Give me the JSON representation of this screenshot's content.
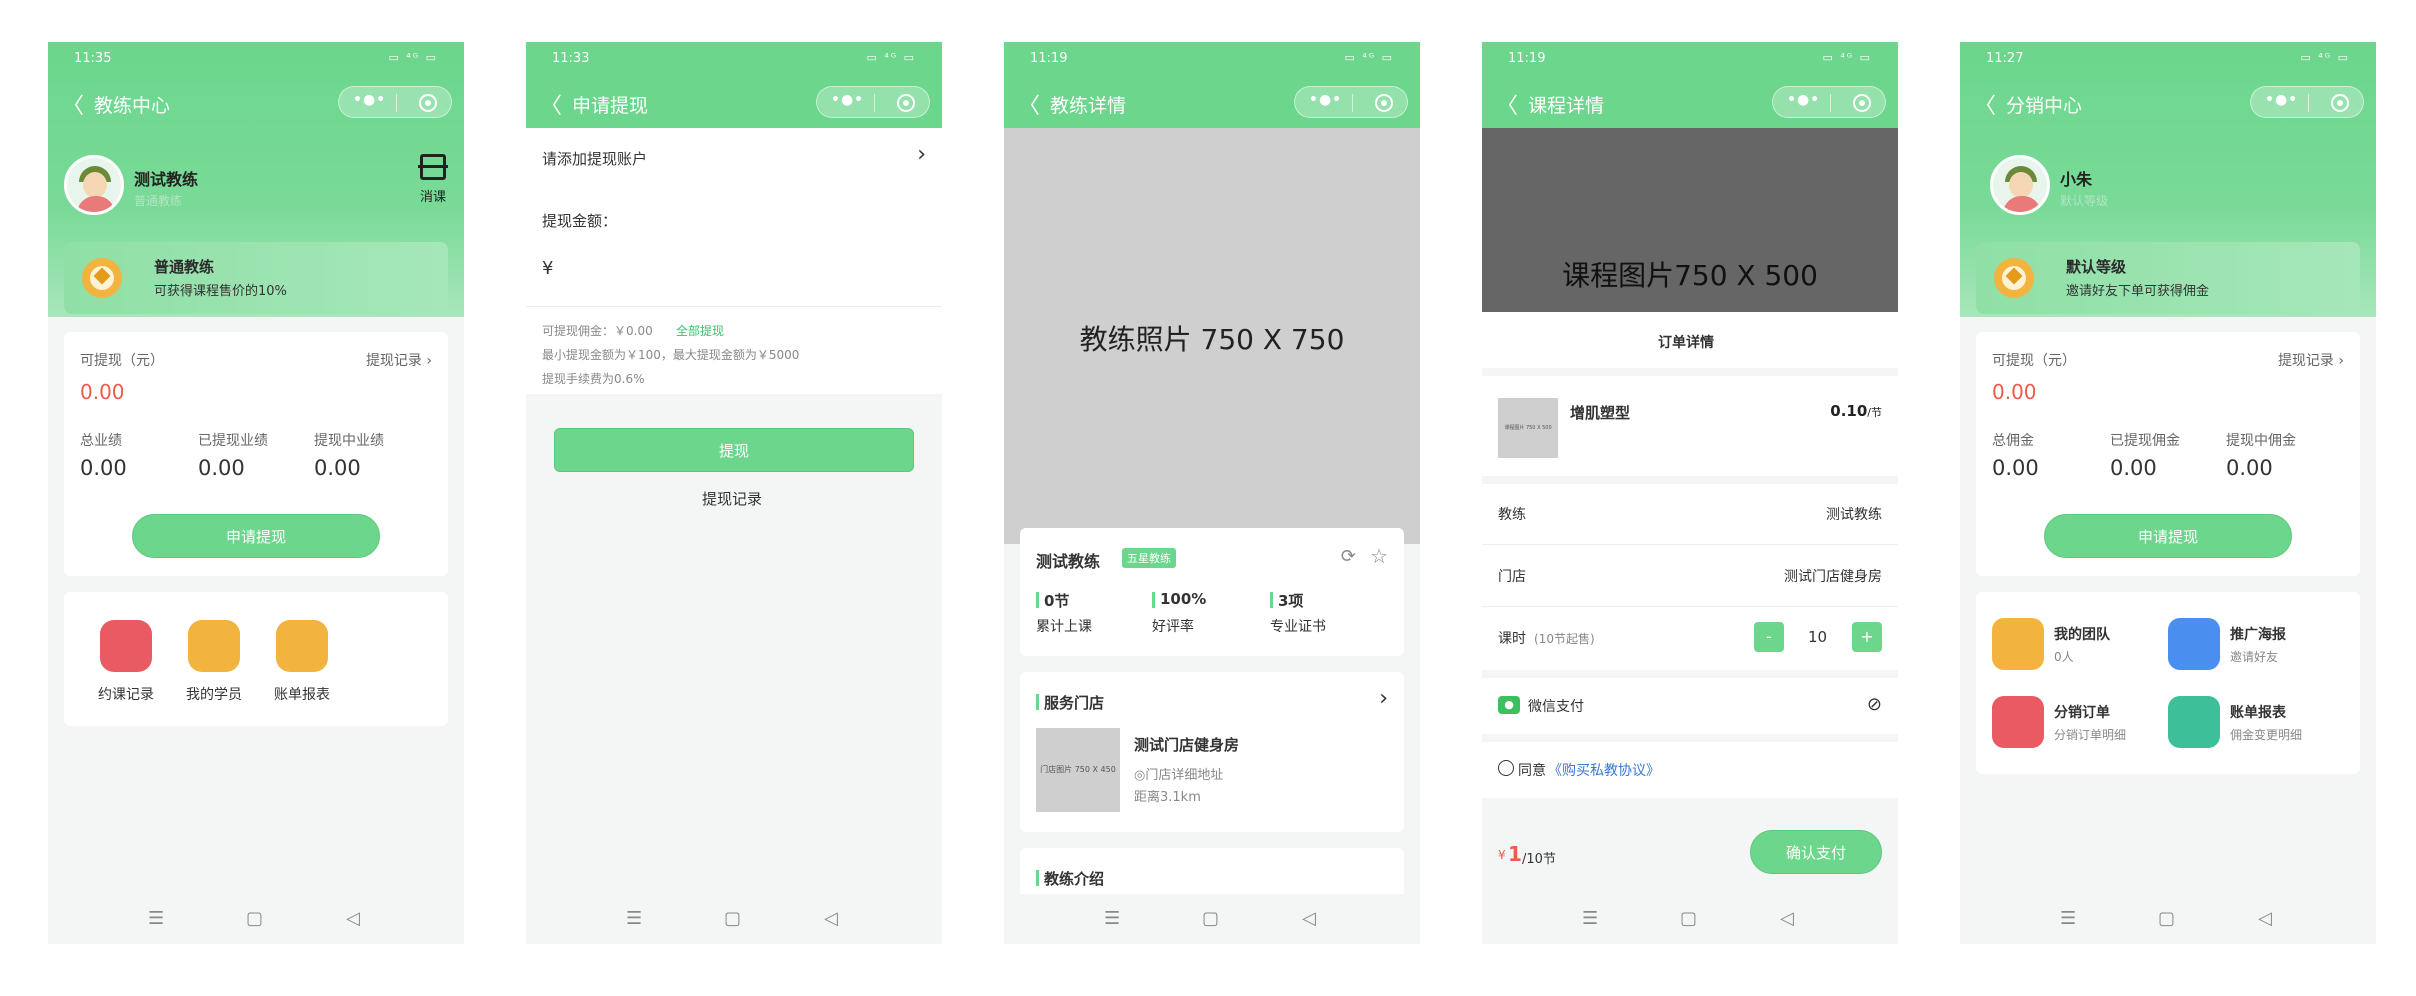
{
  "system": {
    "menu_icon": "☰",
    "home_icon": "▢",
    "back_icon": "◁",
    "back_arrow": "〈",
    "battery": "▭ ⁴ᴳ ▭"
  },
  "p1": {
    "time": "11:35",
    "title": "教练中心",
    "user_name": "测试教练",
    "user_role": "普通教练",
    "scan_label": "消课",
    "level_name": "普通教练",
    "level_desc": "可获得课程售价的10%",
    "withdrawable_label": "可提现（元）",
    "withdrawable_value": "0.00",
    "withdraw_record": "提现记录",
    "stats": [
      {
        "label": "总业绩",
        "value": "0.00"
      },
      {
        "label": "已提现业绩",
        "value": "0.00"
      },
      {
        "label": "提现中业绩",
        "value": "0.00"
      }
    ],
    "apply_btn": "申请提现",
    "apps": [
      "约课记录",
      "我的学员",
      "账单报表"
    ],
    "colors": {
      "green": "#6bd68c",
      "red": "#f05a4b",
      "orange": "#f3b43f"
    }
  },
  "p2": {
    "time": "11:33",
    "title": "申请提现",
    "add_account": "请添加提现账户",
    "amount_label": "提现金额：",
    "currency": "¥",
    "commission_line": "可提现佣金：￥0.00",
    "withdraw_all": "全部提现",
    "limit_line": "最小提现金额为￥100，最大提现金额为￥5000",
    "fee_line": "提现手续费为0.6%",
    "submit_btn": "提现",
    "record_link": "提现记录"
  },
  "p3": {
    "time": "11:19",
    "title": "教练详情",
    "photo_placeholder": "教练照片 750 X 750",
    "coach_name": "测试教练",
    "coach_badge": "五星教练",
    "stats": [
      {
        "value": "0节",
        "label": "累计上课"
      },
      {
        "value": "100%",
        "label": "好评率"
      },
      {
        "value": "3项",
        "label": "专业证书"
      }
    ],
    "store_section": "服务门店",
    "store_name": "测试门店健身房",
    "store_img_text": "门店图片 750 X 450",
    "store_addr": "◎门店详细地址",
    "store_dist": "距离3.1km",
    "intro_section": "教练介绍"
  },
  "p4": {
    "time": "11:19",
    "title": "课程详情",
    "course_img": "课程图片750 X 500",
    "order_title": "订单详情",
    "item_name": "增肌塑型",
    "item_img_text": "课程图片 750 X 500",
    "item_price": "0.10",
    "item_unit": "/节",
    "coach_label": "教练",
    "coach_value": "测试教练",
    "store_label": "门店",
    "store_value": "测试门店健身房",
    "hours_label": "课时",
    "hours_note": "(10节起售)",
    "minus": "-",
    "qty": "10",
    "plus": "+",
    "pay_method": "微信支付",
    "agree_prefix": "同意",
    "agree_link": "《购买私教协议》",
    "total_symbol": "¥",
    "total_value": "1",
    "total_unit": "/10节",
    "confirm_btn": "确认支付"
  },
  "p5": {
    "time": "11:27",
    "title": "分销中心",
    "user_name": "小朱",
    "user_role": "默认等级",
    "level_name": "默认等级",
    "level_desc": "邀请好友下单可获得佣金",
    "withdrawable_label": "可提现（元）",
    "withdrawable_value": "0.00",
    "withdraw_record": "提现记录",
    "stats": [
      {
        "label": "总佣金",
        "value": "0.00"
      },
      {
        "label": "已提现佣金",
        "value": "0.00"
      },
      {
        "label": "提现中佣金",
        "value": "0.00"
      }
    ],
    "apply_btn": "申请提现",
    "menu": [
      {
        "title": "我的团队",
        "sub": "0人"
      },
      {
        "title": "推广海报",
        "sub": "邀请好友"
      },
      {
        "title": "分销订单",
        "sub": "分销订单明细"
      },
      {
        "title": "账单报表",
        "sub": "佣金变更明细"
      }
    ]
  }
}
